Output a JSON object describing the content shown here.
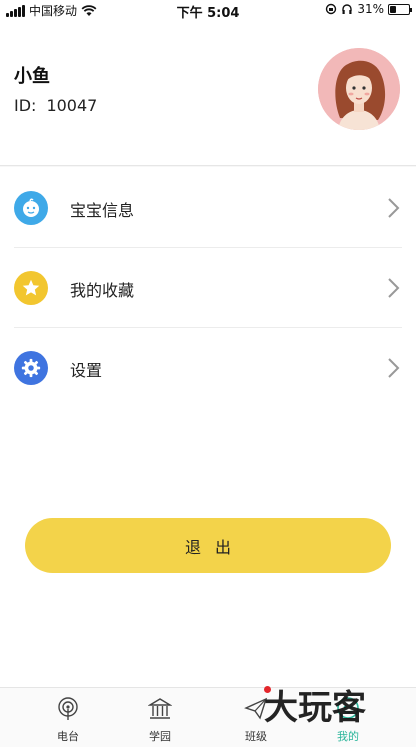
{
  "status_bar": {
    "carrier": "中国移动",
    "time": "下午 5:04",
    "battery": "31%",
    "battery_level": 0.31
  },
  "profile": {
    "username": "小鱼",
    "id_label": "ID:",
    "id_value": "10047"
  },
  "menu": {
    "items": [
      {
        "label": "宝宝信息",
        "icon": "baby-face-icon",
        "color": "#3fa9e8"
      },
      {
        "label": "我的收藏",
        "icon": "star-icon",
        "color": "#f2c62f"
      },
      {
        "label": "设置",
        "icon": "gear-icon",
        "color": "#3f74e0"
      }
    ]
  },
  "logout_label": "退出",
  "tabs": [
    {
      "label": "电台",
      "icon": "radio-icon",
      "active": false
    },
    {
      "label": "学园",
      "icon": "school-icon",
      "active": false
    },
    {
      "label": "班级",
      "icon": "paper-plane-icon",
      "active": false
    },
    {
      "label": "我的",
      "icon": "profile-icon",
      "active": true
    }
  ],
  "watermark": "大玩客",
  "colors": {
    "accent": "#f3d34a",
    "active_tab": "#2bb59a"
  }
}
